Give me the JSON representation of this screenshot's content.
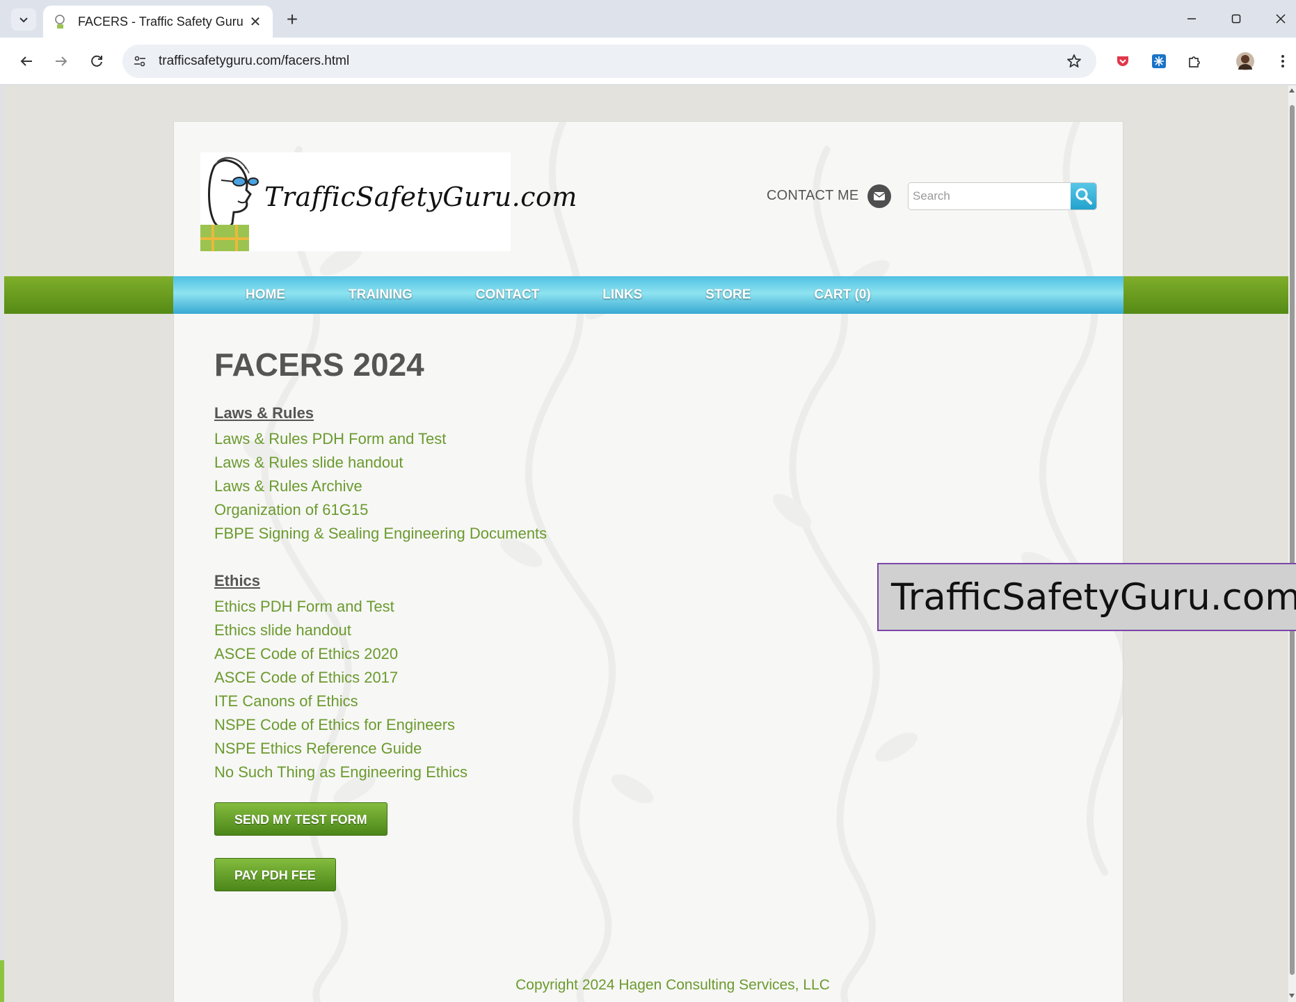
{
  "browser": {
    "tab_title": "FACERS - Traffic Safety Guru",
    "url": "trafficsafetyguru.com/facers.html",
    "new_tab_symbol": "+",
    "tab_close_symbol": "✕"
  },
  "header": {
    "logo_text": "TrafficSafetyGuru.com",
    "contact_me": "CONTACT ME",
    "search_placeholder": "Search"
  },
  "nav": {
    "items": [
      "HOME",
      "TRAINING",
      "CONTACT",
      "LINKS",
      "STORE",
      "CART (0)"
    ]
  },
  "main": {
    "title": "FACERS 2024",
    "sections": [
      {
        "heading": "Laws & Rules",
        "links": [
          "Laws & Rules PDH Form and Test",
          "Laws & Rules slide handout",
          "Laws & Rules Archive",
          "Organization of 61G15",
          "FBPE Signing & Sealing Engineering Documents"
        ]
      },
      {
        "heading": "Ethics",
        "links": [
          "Ethics PDH Form and Test",
          "Ethics slide handout",
          "ASCE Code of Ethics 2020",
          "ASCE Code of Ethics 2017",
          "ITE Canons of Ethics",
          "NSPE Code of Ethics for Engineers",
          "NSPE Ethics Reference Guide",
          "No Such Thing as Engineering Ethics"
        ]
      }
    ],
    "buttons": {
      "send_test_form": "SEND MY TEST FORM",
      "pay_pdh_fee": "PAY PDH FEE"
    }
  },
  "footer": {
    "copyright": "Copyright 2024 Hagen Consulting Services, LLC"
  },
  "overlay": {
    "text": "TrafficSafetyGuru.com/"
  },
  "colors": {
    "link_green": "#6b9a2d",
    "nav_blue": "#4fc0e2",
    "band_green": "#6d9e21",
    "button_green": "#5e9a26"
  }
}
